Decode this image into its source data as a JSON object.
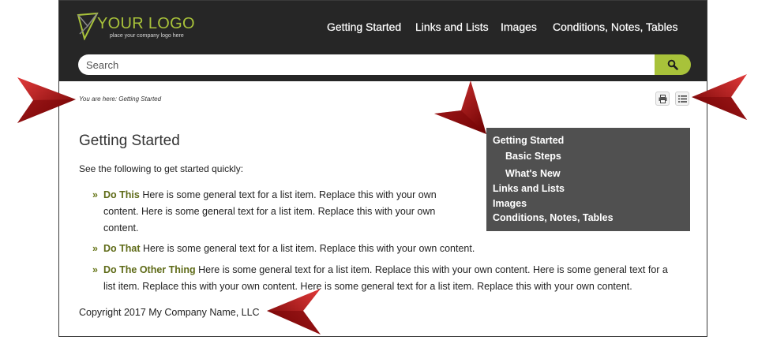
{
  "logo": {
    "text": "YOUR LOGO",
    "tagline": "place your company logo here"
  },
  "nav": {
    "items": [
      "Getting Started",
      "Links and Lists",
      "Images",
      "Conditions, Notes, Tables"
    ]
  },
  "search": {
    "placeholder": "Search"
  },
  "breadcrumb": "You are here: Getting Started",
  "toolbar": {
    "print_icon": "print-icon",
    "toc_icon": "list-icon"
  },
  "page": {
    "title": "Getting Started",
    "intro": "See the following to get started quickly:",
    "list": [
      {
        "term": "Do This",
        "line1": " Here is some general text for a list item. Replace this with your own",
        "line2": "content. Here is some general text for a list item. Replace this with your own",
        "line3": "content."
      },
      {
        "term": "Do That",
        "line1": " Here is some general text for a list item. Replace this with your own content."
      },
      {
        "term": "Do The Other Thing",
        "line1": " Here is some general text for a list item. Replace this with your own content. Here is some general text for a",
        "line2": "list item. Replace this with your own content. Here is some general text for a list item. Replace this with your own content."
      }
    ],
    "bullet": "»",
    "copyright": "Copyright 2017 My Company Name, LLC"
  },
  "toc": {
    "items": [
      "Getting Started",
      "Basic Steps",
      "What's New",
      "Links and Lists",
      "Images",
      "Conditions, Notes, Tables"
    ]
  },
  "colors": {
    "header_bg": "#262626",
    "accent": "#a8c23a",
    "toc_bg": "#505050",
    "arrow": "#b0141c"
  }
}
